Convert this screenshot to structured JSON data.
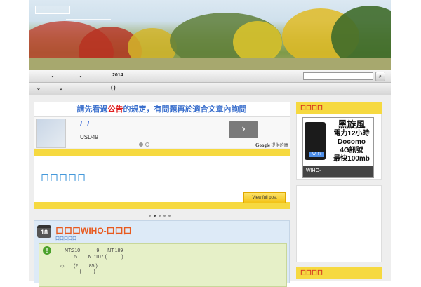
{
  "nav": {
    "row1_arrow_a": "⌄",
    "row1_arrow_b": "⌄",
    "row1_year": "2014",
    "row2_arrow_a": "⌄",
    "row2_arrow_b": "⌄",
    "row2_paren": "(    )",
    "search_icon": "search-icon",
    "search_glyph": "⌕"
  },
  "notice": {
    "pre": "請先看過",
    "highlight": "公告",
    "post": "的規定，有問題再於適合文章內詢問"
  },
  "ad": {
    "title": "/ /",
    "price": "USD49",
    "brand": "Google",
    "brand_suffix": "提供的廣告",
    "arrow": "›"
  },
  "slider": {
    "slide_title": "口口口口口",
    "view_button": "View full post"
  },
  "post": {
    "day": "18",
    "title": "口口口WIHO-口口口",
    "meta": "口口口口口",
    "info_glyph": "!",
    "lines": [
      "NT:210            9      NT:189",
      "5        NT:107 (           )",
      "◇       (2        85 )",
      "        (         )"
    ]
  },
  "sidebar": {
    "widget1_title": "口口口口",
    "promo_line1": "黑旋風",
    "promo_line2": "電力12小時",
    "promo_line3": "Docomo",
    "promo_line4": "4G訊號",
    "promo_line5": "最快100mb",
    "router_label": "Wi-Fi",
    "caption": "WIHO-",
    "widget3_title": "口口口口"
  },
  "colors": {
    "accent_yellow": "#f6d940",
    "link_blue": "#2d8bd6",
    "title_orange": "#e85a1f",
    "notice_red": "#e02020"
  }
}
